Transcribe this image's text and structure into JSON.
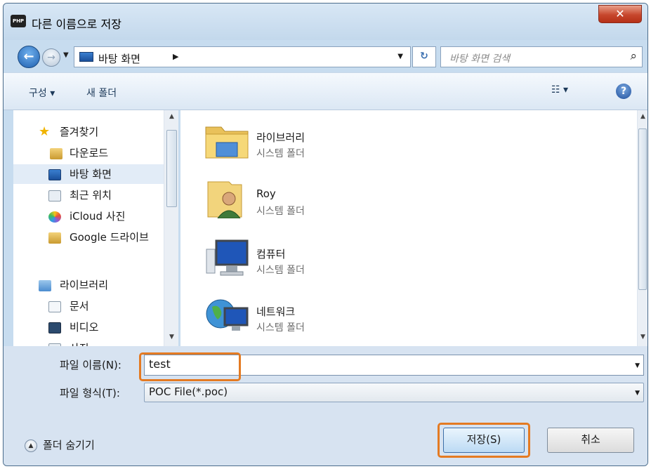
{
  "window": {
    "app_icon_text": "PHP",
    "title": "다른 이름으로 저장",
    "close_glyph": "✕"
  },
  "navbar": {
    "address_path": "바탕 화면",
    "search_placeholder": "바탕 화면 검색"
  },
  "toolbar": {
    "organize_label": "구성 ▾",
    "new_folder_label": "새 폴더"
  },
  "nav_pane": {
    "items": [
      {
        "label": "즐겨찾기",
        "icon": "star-icon"
      },
      {
        "label": "다운로드",
        "icon": "downloads-icon"
      },
      {
        "label": "바탕 화면",
        "icon": "desktop-icon",
        "selected": true
      },
      {
        "label": "최근 위치",
        "icon": "recent-places-icon"
      },
      {
        "label": "iCloud 사진",
        "icon": "icloud-photos-icon"
      },
      {
        "label": "Google 드라이브",
        "icon": "google-drive-icon"
      },
      {
        "label": "라이브러리",
        "icon": "libraries-icon"
      },
      {
        "label": "문서",
        "icon": "documents-icon"
      },
      {
        "label": "비디오",
        "icon": "videos-icon"
      },
      {
        "label": "사진",
        "icon": "pictures-icon"
      }
    ]
  },
  "files": [
    {
      "name": "라이브러리",
      "type": "시스템 폴더",
      "icon": "libraries-folder-icon"
    },
    {
      "name": "Roy",
      "type": "시스템 폴더",
      "icon": "user-folder-icon"
    },
    {
      "name": "컴퓨터",
      "type": "시스템 폴더",
      "icon": "computer-icon"
    },
    {
      "name": "네트워크",
      "type": "시스템 폴더",
      "icon": "network-icon"
    }
  ],
  "form": {
    "filename_label": "파일 이름(N):",
    "filename_value": "test",
    "filetype_label": "파일 형식(T):",
    "filetype_value": "POC File(*.poc)"
  },
  "footer": {
    "hide_folders_label": "폴더 숨기기",
    "save_label": "저장(S)",
    "cancel_label": "취소"
  },
  "colors": {
    "highlight": "#e47a22",
    "selection": "#e2ecf7",
    "window_frame": "#c7dcef"
  }
}
